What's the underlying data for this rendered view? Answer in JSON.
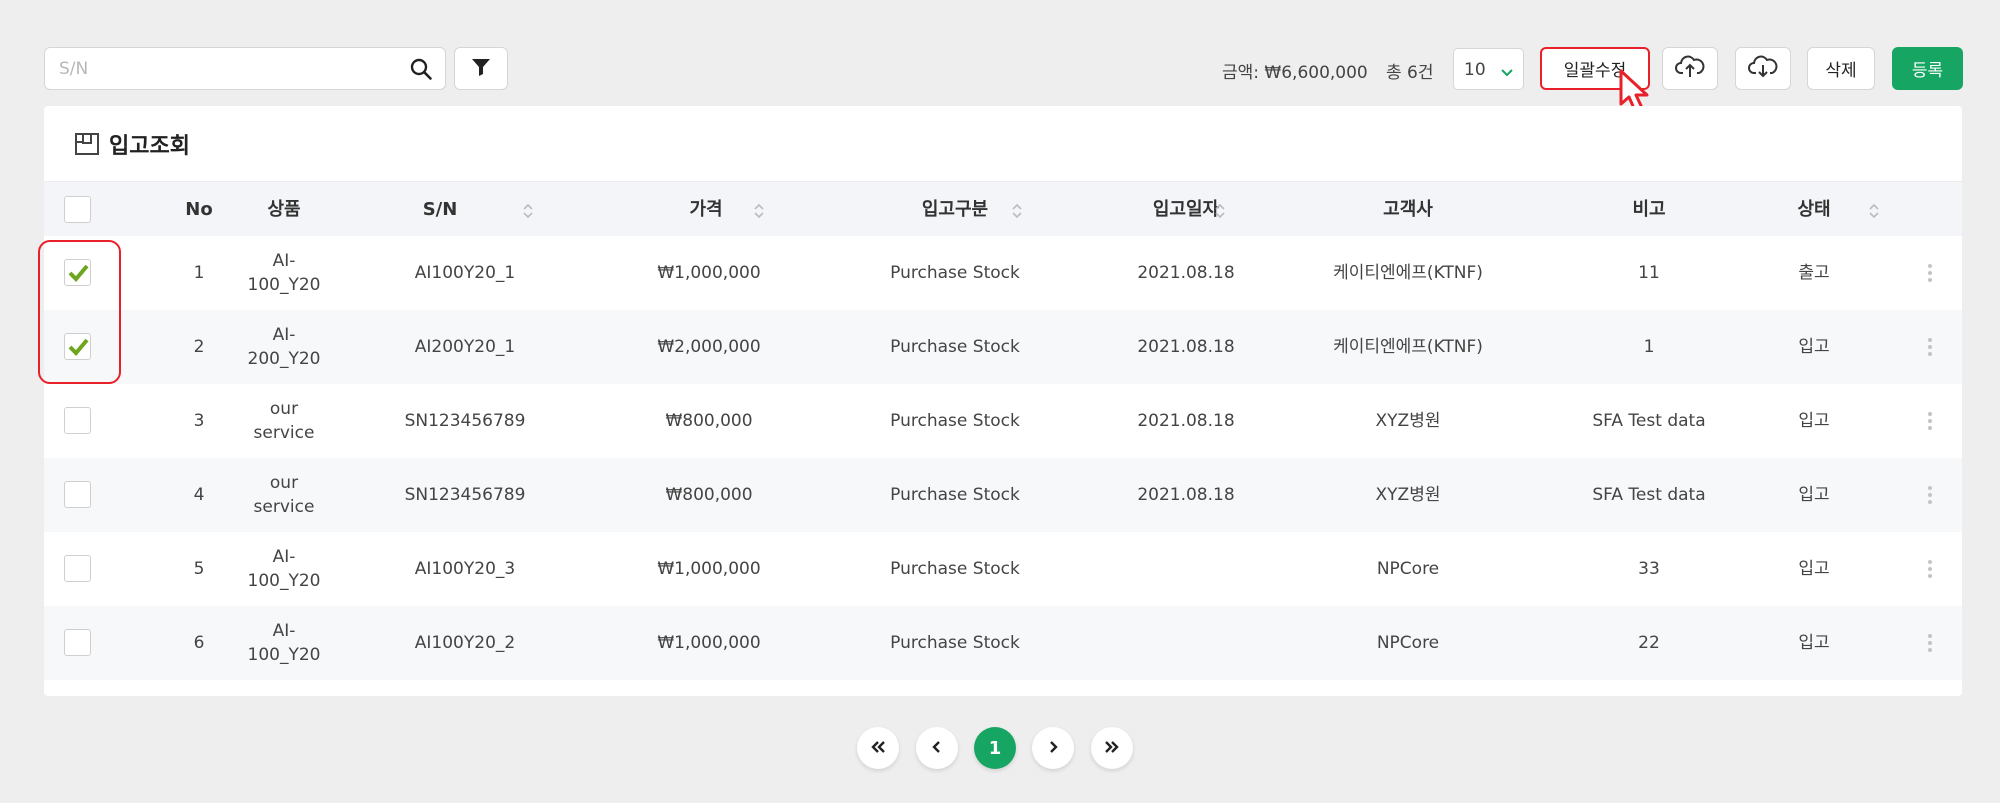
{
  "search": {
    "placeholder": "S/N",
    "value": ""
  },
  "summary": {
    "amount": "금액: ₩6,600,000",
    "count": "총 6건"
  },
  "page_size": {
    "selected": "10"
  },
  "toolbar": {
    "bulk_edit_label": "일괄수정",
    "delete_label": "삭제",
    "register_label": "등록"
  },
  "accent_color": "#16a562",
  "highlight_color": "#e8202a",
  "card": {
    "title": "입고조회"
  },
  "table": {
    "headers": {
      "no": "No",
      "product": "상품",
      "sn": "S/N",
      "price": "가격",
      "type": "입고구분",
      "date": "입고일자",
      "customer": "고객사",
      "note": "비고",
      "status": "상태"
    },
    "rows": [
      {
        "checked": true,
        "no": "1",
        "product": "AI-\n100_Y20",
        "sn": "AI100Y20_1",
        "price": "₩1,000,000",
        "type": "Purchase Stock",
        "date": "2021.08.18",
        "customer": "케이티엔에프(KTNF)",
        "note": "11",
        "status": "출고"
      },
      {
        "checked": true,
        "no": "2",
        "product": "AI-\n200_Y20",
        "sn": "AI200Y20_1",
        "price": "₩2,000,000",
        "type": "Purchase Stock",
        "date": "2021.08.18",
        "customer": "케이티엔에프(KTNF)",
        "note": "1",
        "status": "입고"
      },
      {
        "checked": false,
        "no": "3",
        "product": "our\nservice",
        "sn": "SN123456789",
        "price": "₩800,000",
        "type": "Purchase Stock",
        "date": "2021.08.18",
        "customer": "XYZ병원",
        "note": "SFA Test data",
        "status": "입고"
      },
      {
        "checked": false,
        "no": "4",
        "product": "our\nservice",
        "sn": "SN123456789",
        "price": "₩800,000",
        "type": "Purchase Stock",
        "date": "2021.08.18",
        "customer": "XYZ병원",
        "note": "SFA Test data",
        "status": "입고"
      },
      {
        "checked": false,
        "no": "5",
        "product": "AI-\n100_Y20",
        "sn": "AI100Y20_3",
        "price": "₩1,000,000",
        "type": "Purchase Stock",
        "date": "",
        "customer": "NPCore",
        "note": "33",
        "status": "입고"
      },
      {
        "checked": false,
        "no": "6",
        "product": "AI-\n100_Y20",
        "sn": "AI100Y20_2",
        "price": "₩1,000,000",
        "type": "Purchase Stock",
        "date": "",
        "customer": "NPCore",
        "note": "22",
        "status": "입고"
      }
    ]
  },
  "pagination": {
    "current": "1"
  },
  "icons": {
    "search": "search-icon",
    "filter": "filter-icon",
    "upload": "cloud-upload-icon",
    "download": "cloud-download-icon",
    "title": "box-icon",
    "sort": "sort-icon",
    "more": "kebab-icon",
    "first": "double-chevron-left-icon",
    "prev": "chevron-left-icon",
    "next": "chevron-right-icon",
    "last": "double-chevron-right-icon",
    "pointer": "cursor-icon"
  }
}
